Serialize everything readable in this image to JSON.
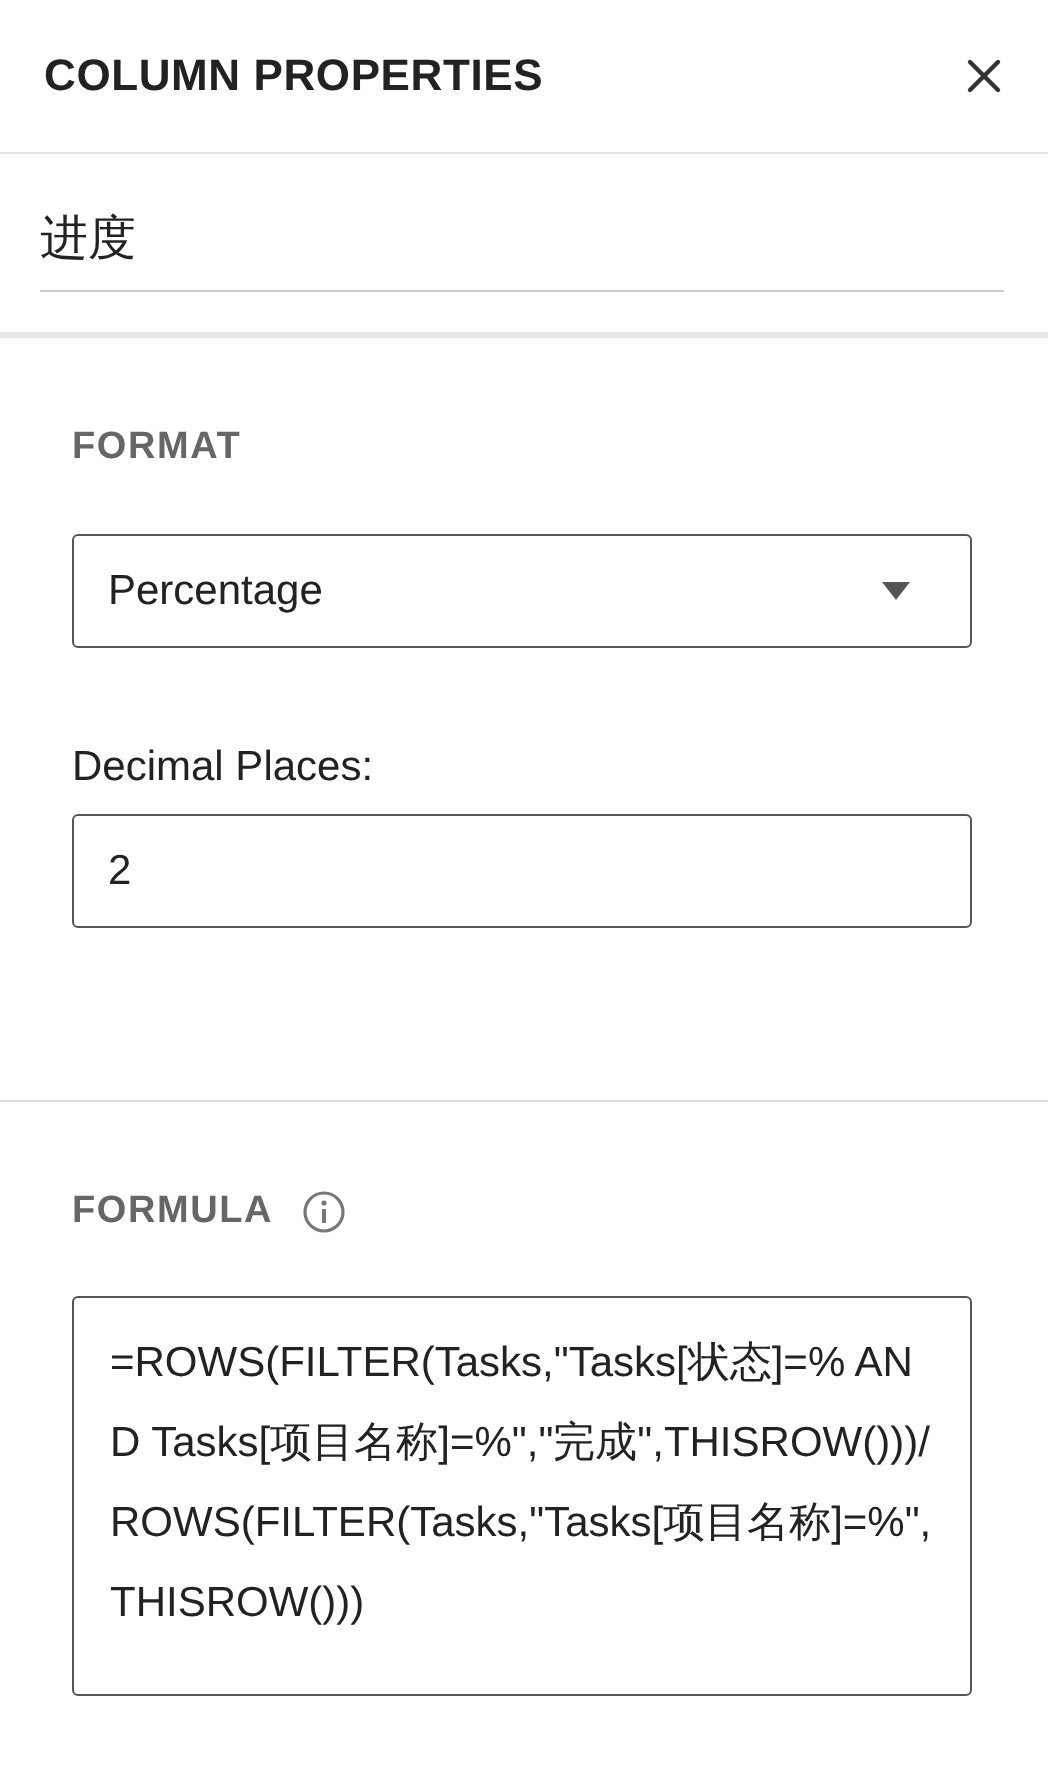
{
  "panel": {
    "title": "COLUMN PROPERTIES"
  },
  "column_name": {
    "value": "进度"
  },
  "format": {
    "label": "FORMAT",
    "value": "Percentage"
  },
  "decimal_places": {
    "label": "Decimal Places:",
    "value": "2"
  },
  "formula": {
    "label": "FORMULA",
    "value": "=ROWS(FILTER(Tasks,\"Tasks[状态]=% AND Tasks[项目名称]=%\",\"完成\",THISROW()))/ROWS(FILTER(Tasks,\"Tasks[项目名称]=%\",THISROW()))"
  }
}
